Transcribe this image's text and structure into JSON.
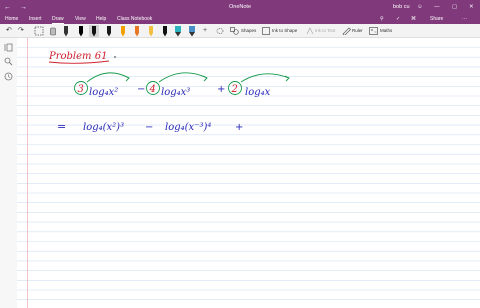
{
  "window": {
    "back_glyph": "←",
    "forward_glyph": "→",
    "title": "OneNote",
    "user": "bob cu",
    "controls": [
      "☺",
      "—",
      "▢",
      "✕"
    ]
  },
  "tabs": [
    {
      "label": "Home"
    },
    {
      "label": "Insert"
    },
    {
      "label": "Draw"
    },
    {
      "label": "View"
    },
    {
      "label": "Help"
    },
    {
      "label": "Class Notebook"
    }
  ],
  "right_icons": [
    "⚲",
    "✓",
    "⌘"
  ],
  "share_label": "Share",
  "more_label": "···",
  "toolbar": {
    "undo": "↶",
    "redo": "↷",
    "add_pen": "+",
    "shapes": "Shapes",
    "ink_to_shape": "Ink to Shape",
    "ink_to_text": "Ink to Text",
    "ruler": "Ruler",
    "maths": "Maths"
  },
  "pens": [
    {
      "color": "#333333"
    },
    {
      "color": "#000000"
    },
    {
      "color": "#111111"
    },
    {
      "color": "#1a1a1a"
    },
    {
      "color": "#f4a000"
    },
    {
      "color": "#e87722"
    },
    {
      "color": "#f0c040"
    },
    {
      "color": "#111111"
    },
    {
      "color": "#2bb3c0"
    },
    {
      "color": "#4a90c8"
    }
  ],
  "colors": {
    "accent": "#80397b",
    "ink_red": "#d0202e",
    "ink_green": "#149a4a",
    "ink_blue": "#2a2ab8",
    "rule_line": "#cfe0f5",
    "margin_line": "#e8a0a8"
  },
  "notes": {
    "heading": "Problem 61",
    "line1": {
      "coef1": "3",
      "term1": "log₄x²",
      "minus": "−",
      "coef2": "4",
      "term2": "log₄x³",
      "plus": "+",
      "coef3": "2",
      "term3": "log₄x"
    },
    "line2": {
      "equals": "=",
      "expr1": "log₄(x²)³",
      "minus": "−",
      "expr2": "log₄(x⁻³)⁴",
      "plus": "+"
    }
  }
}
